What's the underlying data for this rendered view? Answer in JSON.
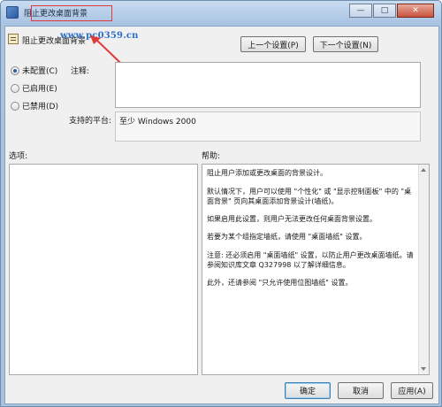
{
  "window": {
    "title": "阻止更改桌面背景",
    "minimize_glyph": "—",
    "maximize_glyph": "□",
    "close_glyph": "✕"
  },
  "policy": {
    "name": "阻止更改桌面背景",
    "watermark": "www.pc0359.cn",
    "prev_label": "上一个设置(P)",
    "next_label": "下一个设置(N)"
  },
  "state": {
    "not_configured": "未配置(C)",
    "enabled": "已启用(E)",
    "disabled": "已禁用(D)",
    "selected": "not_configured"
  },
  "comment": {
    "label": "注释:",
    "value": ""
  },
  "platform": {
    "label": "支持的平台:",
    "value": "至少 Windows 2000"
  },
  "options": {
    "label": "选项:"
  },
  "help": {
    "label": "帮助:",
    "paragraphs": [
      "阻止用户添加或更改桌面的背景设计。",
      "默认情况下，用户可以使用 \"个性化\" 或 \"显示控制面板\" 中的 \"桌面背景\" 页向其桌面添加背景设计(墙纸)。",
      "如果启用此设置，则用户无法更改任何桌面背景设置。",
      "若要为某个组指定墙纸，请使用 \"桌面墙纸\" 设置。",
      "注意: 还必须启用 \"桌面墙纸\" 设置，以防止用户更改桌面墙纸。请参阅知识库文章 Q327998 以了解详细信息。",
      "此外，还请参阅 \"只允许使用位图墙纸\" 设置。"
    ]
  },
  "footer": {
    "ok_label": "确定",
    "cancel_label": "取消",
    "apply_label": "应用(A)"
  },
  "colors": {
    "accent": "#3c7fb1",
    "annotation": "#e03a3a",
    "watermark": "#2c6fc8"
  }
}
